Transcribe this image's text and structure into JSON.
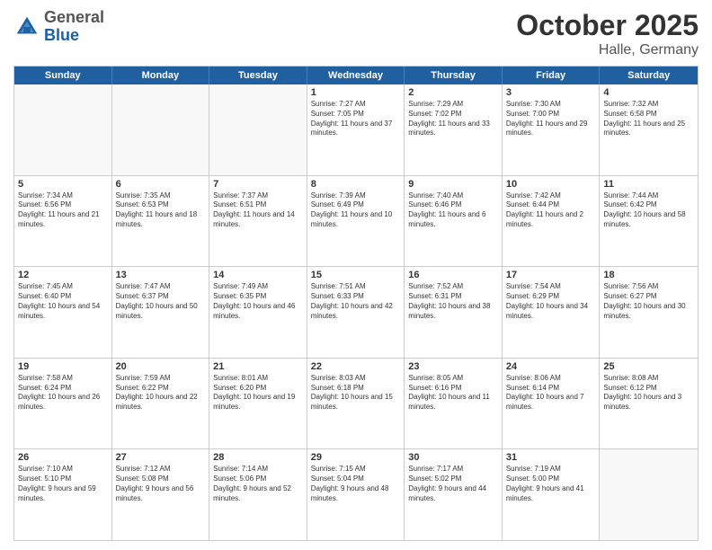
{
  "header": {
    "logo_general": "General",
    "logo_blue": "Blue",
    "month_title": "October 2025",
    "location": "Halle, Germany"
  },
  "weekdays": [
    "Sunday",
    "Monday",
    "Tuesday",
    "Wednesday",
    "Thursday",
    "Friday",
    "Saturday"
  ],
  "rows": [
    [
      {
        "day": "",
        "empty": true
      },
      {
        "day": "",
        "empty": true
      },
      {
        "day": "",
        "empty": true
      },
      {
        "day": "1",
        "sunrise": "7:27 AM",
        "sunset": "7:05 PM",
        "daylight": "11 hours and 37 minutes."
      },
      {
        "day": "2",
        "sunrise": "7:29 AM",
        "sunset": "7:02 PM",
        "daylight": "11 hours and 33 minutes."
      },
      {
        "day": "3",
        "sunrise": "7:30 AM",
        "sunset": "7:00 PM",
        "daylight": "11 hours and 29 minutes."
      },
      {
        "day": "4",
        "sunrise": "7:32 AM",
        "sunset": "6:58 PM",
        "daylight": "11 hours and 25 minutes."
      }
    ],
    [
      {
        "day": "5",
        "sunrise": "7:34 AM",
        "sunset": "6:56 PM",
        "daylight": "11 hours and 21 minutes."
      },
      {
        "day": "6",
        "sunrise": "7:35 AM",
        "sunset": "6:53 PM",
        "daylight": "11 hours and 18 minutes."
      },
      {
        "day": "7",
        "sunrise": "7:37 AM",
        "sunset": "6:51 PM",
        "daylight": "11 hours and 14 minutes."
      },
      {
        "day": "8",
        "sunrise": "7:39 AM",
        "sunset": "6:49 PM",
        "daylight": "11 hours and 10 minutes."
      },
      {
        "day": "9",
        "sunrise": "7:40 AM",
        "sunset": "6:46 PM",
        "daylight": "11 hours and 6 minutes."
      },
      {
        "day": "10",
        "sunrise": "7:42 AM",
        "sunset": "6:44 PM",
        "daylight": "11 hours and 2 minutes."
      },
      {
        "day": "11",
        "sunrise": "7:44 AM",
        "sunset": "6:42 PM",
        "daylight": "10 hours and 58 minutes."
      }
    ],
    [
      {
        "day": "12",
        "sunrise": "7:45 AM",
        "sunset": "6:40 PM",
        "daylight": "10 hours and 54 minutes."
      },
      {
        "day": "13",
        "sunrise": "7:47 AM",
        "sunset": "6:37 PM",
        "daylight": "10 hours and 50 minutes."
      },
      {
        "day": "14",
        "sunrise": "7:49 AM",
        "sunset": "6:35 PM",
        "daylight": "10 hours and 46 minutes."
      },
      {
        "day": "15",
        "sunrise": "7:51 AM",
        "sunset": "6:33 PM",
        "daylight": "10 hours and 42 minutes."
      },
      {
        "day": "16",
        "sunrise": "7:52 AM",
        "sunset": "6:31 PM",
        "daylight": "10 hours and 38 minutes."
      },
      {
        "day": "17",
        "sunrise": "7:54 AM",
        "sunset": "6:29 PM",
        "daylight": "10 hours and 34 minutes."
      },
      {
        "day": "18",
        "sunrise": "7:56 AM",
        "sunset": "6:27 PM",
        "daylight": "10 hours and 30 minutes."
      }
    ],
    [
      {
        "day": "19",
        "sunrise": "7:58 AM",
        "sunset": "6:24 PM",
        "daylight": "10 hours and 26 minutes."
      },
      {
        "day": "20",
        "sunrise": "7:59 AM",
        "sunset": "6:22 PM",
        "daylight": "10 hours and 22 minutes."
      },
      {
        "day": "21",
        "sunrise": "8:01 AM",
        "sunset": "6:20 PM",
        "daylight": "10 hours and 19 minutes."
      },
      {
        "day": "22",
        "sunrise": "8:03 AM",
        "sunset": "6:18 PM",
        "daylight": "10 hours and 15 minutes."
      },
      {
        "day": "23",
        "sunrise": "8:05 AM",
        "sunset": "6:16 PM",
        "daylight": "10 hours and 11 minutes."
      },
      {
        "day": "24",
        "sunrise": "8:06 AM",
        "sunset": "6:14 PM",
        "daylight": "10 hours and 7 minutes."
      },
      {
        "day": "25",
        "sunrise": "8:08 AM",
        "sunset": "6:12 PM",
        "daylight": "10 hours and 3 minutes."
      }
    ],
    [
      {
        "day": "26",
        "sunrise": "7:10 AM",
        "sunset": "5:10 PM",
        "daylight": "9 hours and 59 minutes."
      },
      {
        "day": "27",
        "sunrise": "7:12 AM",
        "sunset": "5:08 PM",
        "daylight": "9 hours and 56 minutes."
      },
      {
        "day": "28",
        "sunrise": "7:14 AM",
        "sunset": "5:06 PM",
        "daylight": "9 hours and 52 minutes."
      },
      {
        "day": "29",
        "sunrise": "7:15 AM",
        "sunset": "5:04 PM",
        "daylight": "9 hours and 48 minutes."
      },
      {
        "day": "30",
        "sunrise": "7:17 AM",
        "sunset": "5:02 PM",
        "daylight": "9 hours and 44 minutes."
      },
      {
        "day": "31",
        "sunrise": "7:19 AM",
        "sunset": "5:00 PM",
        "daylight": "9 hours and 41 minutes."
      },
      {
        "day": "",
        "empty": true
      }
    ]
  ]
}
